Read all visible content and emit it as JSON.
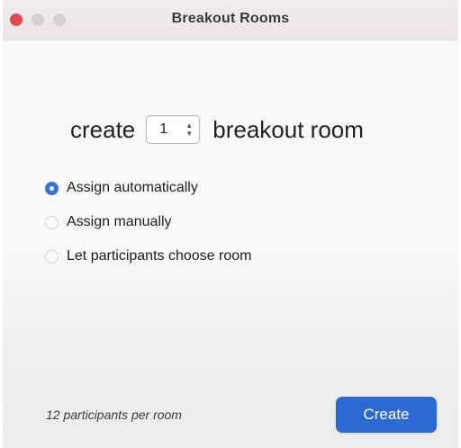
{
  "window": {
    "title": "Breakout Rooms"
  },
  "create_row": {
    "prefix": "create",
    "room_count": "1",
    "suffix": "breakout room"
  },
  "assignment_options": [
    {
      "label": "Assign automatically",
      "selected": true
    },
    {
      "label": "Assign manually",
      "selected": false
    },
    {
      "label": "Let participants choose room",
      "selected": false
    }
  ],
  "footer": {
    "participants_per_room": "12 participants per room",
    "create_button": "Create"
  },
  "colors": {
    "accent": "#2b6ad4",
    "close_button": "#e5484d"
  }
}
